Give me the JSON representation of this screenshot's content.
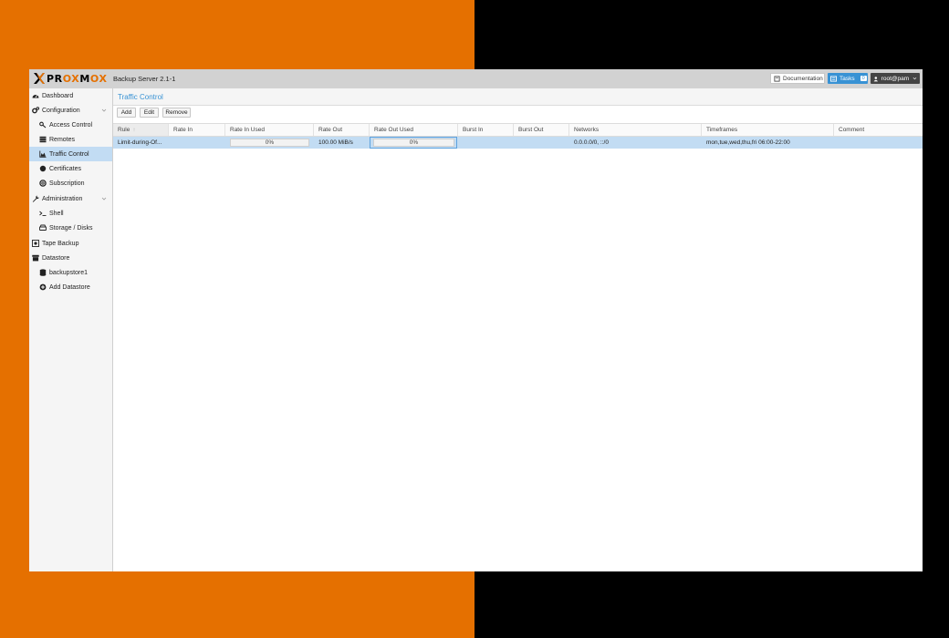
{
  "header": {
    "logo_prefix": "PR",
    "logo_ox1": "OX",
    "logo_mid": "M",
    "logo_ox2": "OX",
    "version": "Backup Server 2.1-1",
    "documentation_label": "Documentation",
    "tasks_label": "Tasks",
    "tasks_count": "0",
    "user_label": "root@pam"
  },
  "sidebar": {
    "items": [
      {
        "label": "Dashboard",
        "icon": "dashboard-icon"
      },
      {
        "label": "Configuration",
        "icon": "gears-icon"
      },
      {
        "label": "Access Control",
        "icon": "key-icon"
      },
      {
        "label": "Remotes",
        "icon": "server-icon"
      },
      {
        "label": "Traffic Control",
        "icon": "area-chart-icon"
      },
      {
        "label": "Certificates",
        "icon": "certificate-icon"
      },
      {
        "label": "Subscription",
        "icon": "support-icon"
      },
      {
        "label": "Administration",
        "icon": "wrench-icon"
      },
      {
        "label": "Shell",
        "icon": "terminal-icon"
      },
      {
        "label": "Storage / Disks",
        "icon": "hdd-icon"
      },
      {
        "label": "Tape Backup",
        "icon": "tape-icon"
      },
      {
        "label": "Datastore",
        "icon": "archive-icon"
      },
      {
        "label": "backupstore1",
        "icon": "database-icon"
      },
      {
        "label": "Add Datastore",
        "icon": "plus-circle-icon"
      }
    ]
  },
  "main": {
    "title": "Traffic Control",
    "toolbar": {
      "add": "Add",
      "edit": "Edit",
      "remove": "Remove"
    },
    "columns": [
      "Rule",
      "Rate In",
      "Rate In Used",
      "Rate Out",
      "Rate Out Used",
      "Burst In",
      "Burst Out",
      "Networks",
      "Timeframes",
      "Comment"
    ],
    "sort_indicator": "↑",
    "rows": [
      {
        "rule": "Limit-during-Of...",
        "rate_in": "",
        "rate_in_used": "0%",
        "rate_in_used_value": 0,
        "rate_out": "100.00 MiB/s",
        "rate_out_used": "0%",
        "rate_out_used_value": 0,
        "burst_in": "",
        "burst_out": "",
        "networks": "0.0.0.0/0, ::/0",
        "timeframes": "mon,tue,wed,thu,fri 06:00-22:00",
        "comment": ""
      }
    ]
  },
  "colors": {
    "accent": "#3892d4",
    "brand_orange": "#e57000",
    "selection": "#c2dcf3"
  }
}
